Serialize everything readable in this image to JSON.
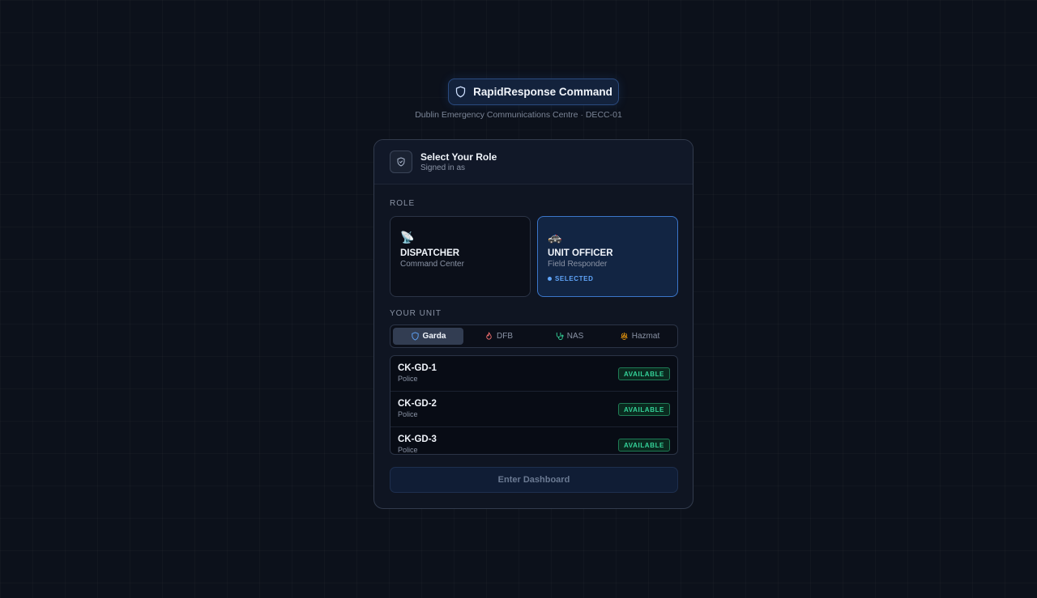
{
  "brand": {
    "title": "RapidResponse Command",
    "subtitle": "Dublin Emergency Communications Centre · DECC-01"
  },
  "header": {
    "title": "Select Your Role",
    "subtitle": "Signed in as"
  },
  "role_section": {
    "label": "ROLE"
  },
  "roles": [
    {
      "emoji": "📡",
      "name": "DISPATCHER",
      "desc": "Command Center",
      "selected": false
    },
    {
      "emoji": "🚓",
      "name": "UNIT OFFICER",
      "desc": "Field Responder",
      "selected": true,
      "selected_label": "SELECTED"
    }
  ],
  "unit_section": {
    "label": "YOUR UNIT"
  },
  "unit_tabs": [
    {
      "label": "Garda",
      "icon": "shield-icon",
      "color": "#60a5fa",
      "active": true
    },
    {
      "label": "DFB",
      "icon": "flame-icon",
      "color": "#f87171",
      "active": false
    },
    {
      "label": "NAS",
      "icon": "stethoscope-icon",
      "color": "#34d399",
      "active": false
    },
    {
      "label": "Hazmat",
      "icon": "biohazard-icon",
      "color": "#f59e0b",
      "active": false
    }
  ],
  "units": [
    {
      "code": "CK-GD-1",
      "type": "Police",
      "status": "AVAILABLE"
    },
    {
      "code": "CK-GD-2",
      "type": "Police",
      "status": "AVAILABLE"
    },
    {
      "code": "CK-GD-3",
      "type": "Police",
      "status": "AVAILABLE"
    }
  ],
  "enter_button": {
    "label": "Enter Dashboard"
  }
}
